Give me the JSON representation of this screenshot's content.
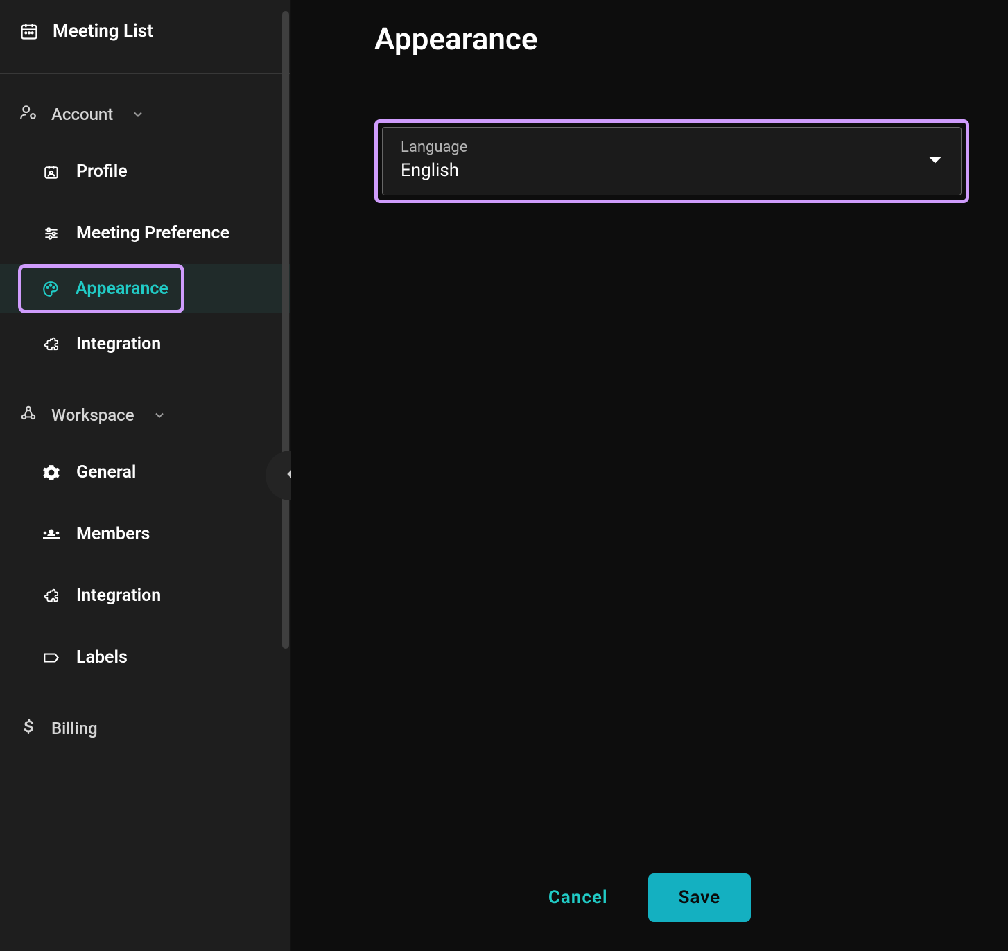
{
  "sidebar": {
    "meeting_list_label": "Meeting List",
    "sections": {
      "account": {
        "label": "Account",
        "items": [
          {
            "id": "profile",
            "label": "Profile"
          },
          {
            "id": "meeting-preference",
            "label": "Meeting Preference"
          },
          {
            "id": "appearance",
            "label": "Appearance",
            "active": true
          },
          {
            "id": "integration",
            "label": "Integration"
          }
        ]
      },
      "workspace": {
        "label": "Workspace",
        "items": [
          {
            "id": "general",
            "label": "General"
          },
          {
            "id": "members",
            "label": "Members"
          },
          {
            "id": "integration-ws",
            "label": "Integration"
          },
          {
            "id": "labels",
            "label": "Labels"
          }
        ]
      }
    },
    "billing_label": "Billing"
  },
  "main": {
    "title": "Appearance",
    "language": {
      "label": "Language",
      "value": "English"
    },
    "actions": {
      "cancel": "Cancel",
      "save": "Save"
    }
  },
  "colors": {
    "accent": "#21cbc6",
    "highlight_border": "#cf9cfc",
    "save_bg": "#14b0c1"
  }
}
